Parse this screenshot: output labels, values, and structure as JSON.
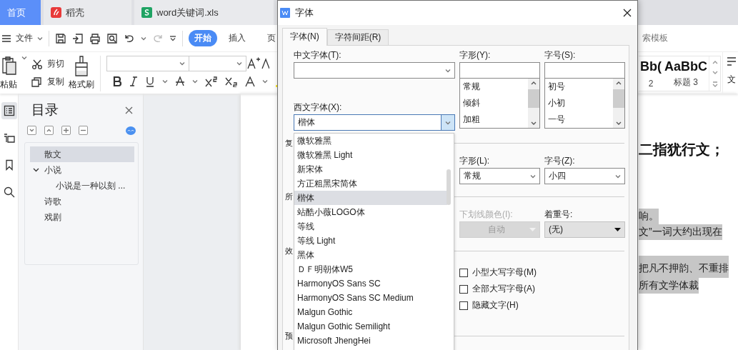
{
  "app_tabs": [
    {
      "label": "首页",
      "kind": "home",
      "selected": true
    },
    {
      "label": "稻壳",
      "kind": "docer",
      "selected": false
    },
    {
      "label": "word关键词.xls",
      "kind": "spreadsheet",
      "selected": false
    }
  ],
  "toolbar": {
    "menu": "文件",
    "tabs": [
      {
        "label": "开始",
        "selected": true
      },
      {
        "label": "插入",
        "selected": false
      },
      {
        "label": "页",
        "selected": false
      }
    ],
    "search": "索模板"
  },
  "ribbon": {
    "paste": "粘贴",
    "cut": "剪切",
    "copy": "复制",
    "format_painter": "格式刷",
    "styles": [
      {
        "preview": "Bb(",
        "label": "2"
      },
      {
        "preview": "AaBbC",
        "label": "标题 3"
      }
    ],
    "text_tool": "文"
  },
  "left_rail": [
    {
      "kind": "outline",
      "selected": true
    },
    {
      "kind": "navigation",
      "selected": false
    },
    {
      "kind": "bookmark",
      "selected": false
    },
    {
      "kind": "search",
      "selected": false
    }
  ],
  "outline": {
    "title": "目录",
    "items": [
      {
        "label": "散文",
        "selected": true
      },
      {
        "label": "小说",
        "selected": false,
        "expanded": true,
        "children": [
          {
            "label": "小说是一种以刻 ...",
            "selected": false
          }
        ]
      },
      {
        "label": "诗歌",
        "selected": false
      },
      {
        "label": "戏剧",
        "selected": false
      }
    ]
  },
  "document": {
    "heading": "二指犹行文；",
    "lines": [
      {
        "text": "响。",
        "highlighted": true
      },
      {
        "text": "文”一词大约出现在",
        "highlighted": true
      },
      {
        "text": "把凡不押韵、不重排",
        "highlighted": true
      },
      {
        "text": "所有文学体裁",
        "highlighted": true
      }
    ]
  },
  "dialog": {
    "title": "字体",
    "tabs": [
      {
        "label": "字体(N)",
        "selected": true
      },
      {
        "label": "字符间距(R)",
        "selected": false
      }
    ],
    "chinese_font": {
      "label": "中文字体(T):"
    },
    "western_font": {
      "label": "西文字体(X):",
      "value": "楷体",
      "expanded": true
    },
    "style": {
      "label": "字形(Y):",
      "options": [
        "常规",
        "倾斜",
        "加粗"
      ]
    },
    "size": {
      "label": "字号(S):",
      "options": [
        "初号",
        "小初",
        "一号"
      ]
    },
    "complex_script": {
      "caption": "复",
      "style": {
        "label": "字形(L):",
        "value": "常规"
      },
      "size": {
        "label": "字号(Z):",
        "value": "小四"
      }
    },
    "all_text": {
      "caption": "所",
      "underline_color": {
        "label": "下划线颜色(I):",
        "value": "自动",
        "disabled": true
      },
      "emphasis": {
        "label": "着重号:",
        "value": "(无)",
        "disabled": false
      }
    },
    "effects": {
      "caption": "效",
      "options": [
        {
          "label": "小型大写字母(M)",
          "checked": false
        },
        {
          "label": "全部大写字母(A)",
          "checked": false
        },
        {
          "label": "隐藏文字(H)",
          "checked": false
        }
      ]
    },
    "preview": {
      "caption": "预"
    },
    "font_list": [
      {
        "label": "微软雅黑",
        "selected": false
      },
      {
        "label": "微软雅黑 Light",
        "selected": false
      },
      {
        "label": "新宋体",
        "selected": false
      },
      {
        "label": "方正粗黑宋简体",
        "selected": false
      },
      {
        "label": "楷体",
        "selected": true
      },
      {
        "label": "站酷小薇LOGO体",
        "selected": false
      },
      {
        "label": "等线",
        "selected": false
      },
      {
        "label": "等线 Light",
        "selected": false
      },
      {
        "label": "黑体",
        "selected": false
      },
      {
        "label": "ＤＦ明朝体W5",
        "selected": false
      },
      {
        "label": "HarmonyOS Sans SC",
        "selected": false
      },
      {
        "label": "HarmonyOS Sans SC Medium",
        "selected": false
      },
      {
        "label": "Malgun Gothic",
        "selected": false
      },
      {
        "label": "Malgun Gothic Semilight",
        "selected": false
      },
      {
        "label": "Microsoft JhengHei",
        "selected": false
      }
    ]
  }
}
